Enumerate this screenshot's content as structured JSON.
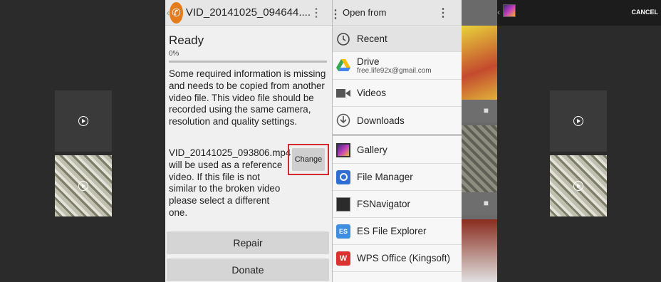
{
  "app": {
    "title": "VID_20141025_094644....",
    "status": "Ready",
    "progress_text": "0%",
    "progress": 0,
    "info_text": "Some required information is missing and needs to be copied from another video file. This video file should be recorded using the same camera, resolution and quality settings.",
    "reference_text": "VID_20141025_093806.mp4 will be used as a reference video. If this file is not similar to the broken video please select a different one.",
    "change_label": "Change",
    "repair_label": "Repair",
    "donate_label": "Donate"
  },
  "sheet": {
    "title": "Open from",
    "items": [
      {
        "label": "Recent",
        "icon": "clock-icon"
      },
      {
        "label": "Drive",
        "sub": "free.life92x@gmail.com",
        "icon": "drive-icon"
      },
      {
        "label": "Videos",
        "icon": "video-icon"
      },
      {
        "label": "Downloads",
        "icon": "download-icon"
      },
      {
        "label": "Gallery",
        "icon": "gallery-icon"
      },
      {
        "label": "File Manager",
        "icon": "file-manager-icon"
      },
      {
        "label": "FSNavigator",
        "icon": "fsnavigator-icon"
      },
      {
        "label": "ES File Explorer",
        "icon": "es-file-explorer-icon"
      },
      {
        "label": "WPS Office (Kingsoft)",
        "icon": "wps-office-icon"
      }
    ]
  },
  "right": {
    "cancel_label": "CANCEL"
  }
}
